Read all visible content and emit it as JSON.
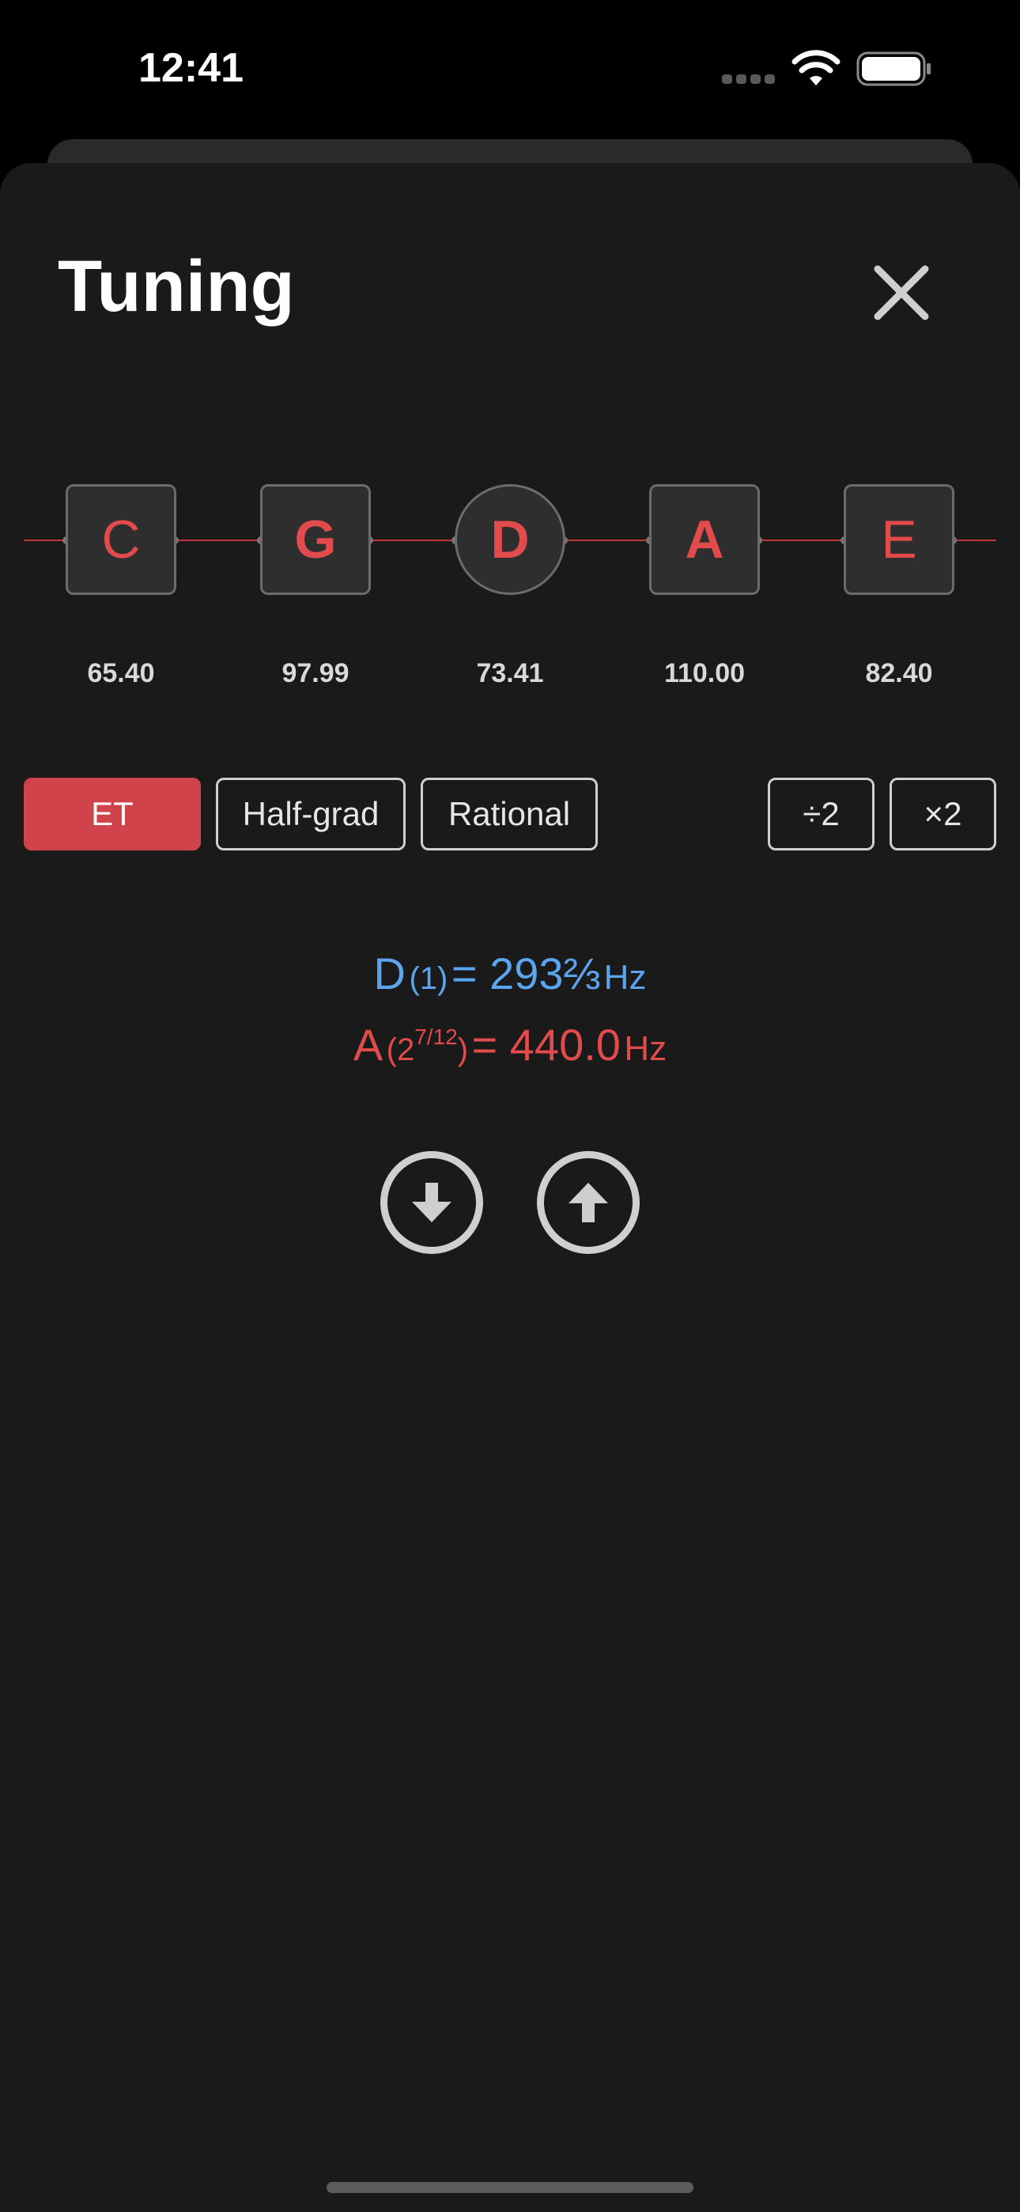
{
  "status_bar": {
    "time": "12:41"
  },
  "sheet": {
    "title": "Tuning",
    "close_icon": "close-icon"
  },
  "strings": [
    {
      "note": "C",
      "freq": "65.40",
      "shape": "square",
      "bold": false
    },
    {
      "note": "G",
      "freq": "97.99",
      "shape": "square",
      "bold": true
    },
    {
      "note": "D",
      "freq": "73.41",
      "shape": "circle",
      "bold": true
    },
    {
      "note": "A",
      "freq": "110.00",
      "shape": "square",
      "bold": true
    },
    {
      "note": "E",
      "freq": "82.40",
      "shape": "square",
      "bold": false
    }
  ],
  "modes": {
    "et": "ET",
    "half_grad": "Half-grad",
    "rational": "Rational",
    "selected": "ET"
  },
  "octave": {
    "divide": "÷2",
    "multiply": "×2"
  },
  "readout": {
    "blue": {
      "note": "D",
      "ratio": "1",
      "eq": "= 293⅔",
      "unit": "Hz"
    },
    "red": {
      "note": "A",
      "ratio_base": "2",
      "ratio_exp": "7/12",
      "eq": "= 440.0",
      "unit": "Hz"
    }
  },
  "icons": {
    "down": "arrow-down-circle-icon",
    "up": "arrow-up-circle-icon",
    "wifi": "wifi-icon",
    "battery": "battery-icon",
    "signal": "cellular-signal-icon"
  },
  "colors": {
    "accent_red": "#d0434a",
    "note_red": "#e14b4b",
    "blue": "#5ba4ee",
    "sheet_bg": "#1a1a1a"
  }
}
